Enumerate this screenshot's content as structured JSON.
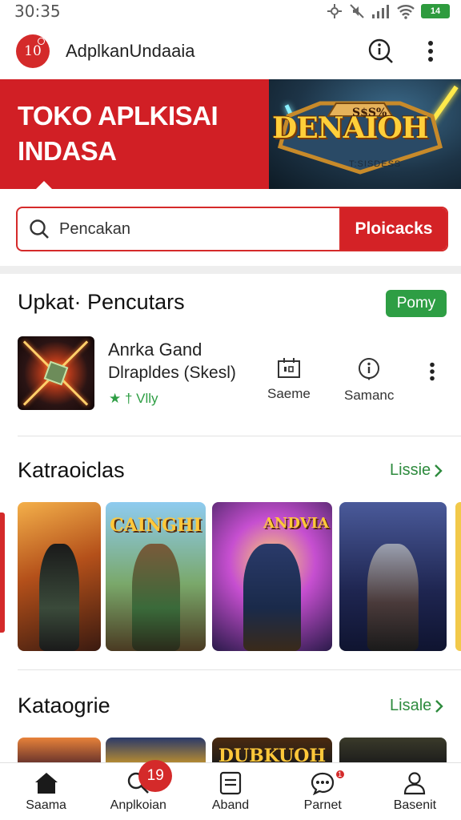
{
  "status_bar": {
    "time": "30:35",
    "battery": "14"
  },
  "app_bar": {
    "logo_text": "10",
    "title": "AdplkanUndaaia",
    "icons": [
      "search-info-icon",
      "more-vertical-icon"
    ]
  },
  "banner": {
    "title": "TOKO APLKISAI INDASA",
    "game_logo_top": "S$S%",
    "game_logo_title": "DENAIOH",
    "game_logo_sub": "T:SISDESS"
  },
  "search": {
    "placeholder": "Pencakan",
    "button_label": "Ploicacks"
  },
  "section_updates": {
    "title": "Upkat· Pencutars",
    "pill": "Pomy",
    "app": {
      "name": "Anrka Gand",
      "description": "Dlrapldes (Skesl)",
      "rating_text": "★ † Vlly",
      "actions": [
        {
          "label": "Saeme",
          "icon": "calendar-icon"
        },
        {
          "label": "Samanc",
          "icon": "info-icon"
        }
      ]
    }
  },
  "section_categories_1": {
    "title": "Katraoiclas",
    "more_label": "Lissie",
    "cards": [
      {
        "title": "",
        "colors": [
          "#f0a23a",
          "#3a1a10"
        ]
      },
      {
        "title": "CAINGHI",
        "colors": [
          "#7ac0e8",
          "#6a4a2a"
        ]
      },
      {
        "title": "ANDVIA",
        "colors": [
          "#c64fd0",
          "#2a1a4a"
        ]
      },
      {
        "title": "",
        "colors": [
          "#3a4a8a",
          "#0f1430"
        ]
      }
    ]
  },
  "section_categories_2": {
    "title": "Kataogrie",
    "more_label": "Lisale",
    "peek_titles": [
      "",
      "",
      "DUBKUOH",
      ""
    ]
  },
  "bottom_nav": {
    "items": [
      {
        "label": "Saama",
        "icon": "home-icon"
      },
      {
        "label": "Anplkoian",
        "icon": "search-icon",
        "badge": "19"
      },
      {
        "label": "Aband",
        "icon": "list-icon"
      },
      {
        "label": "Parnet",
        "icon": "chat-icon",
        "badge": "1"
      },
      {
        "label": "Basenit",
        "icon": "person-icon"
      }
    ]
  },
  "colors": {
    "brand_red": "#d42226",
    "accent_green": "#2e9e44"
  }
}
